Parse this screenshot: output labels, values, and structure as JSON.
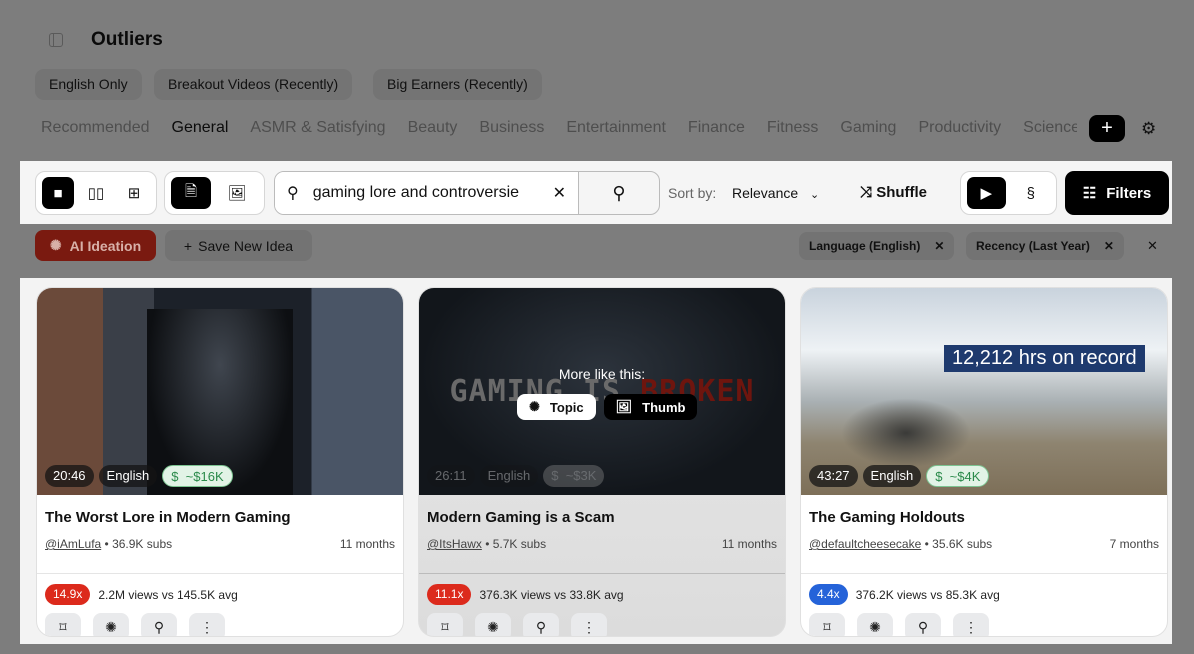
{
  "header": {
    "title": "Outliers",
    "sidebar_icon": "sidebar-toggle-icon"
  },
  "presets": [
    "English Only",
    "Breakout Videos (Recently)",
    "Big Earners (Recently)"
  ],
  "tabs": [
    "Recommended",
    "General",
    "ASMR & Satisfying",
    "Beauty",
    "Business",
    "Entertainment",
    "Finance",
    "Fitness",
    "Gaming",
    "Productivity",
    "Science"
  ],
  "active_tab": "General",
  "toolbar": {
    "search_value": "gaming lore and controversie",
    "sort_label": "Sort by:",
    "sort_value": "Relevance",
    "shuffle": "Shuffle",
    "filters": "Filters"
  },
  "actions": {
    "ai_ideation": "AI Ideation",
    "save_idea": "Save New Idea"
  },
  "active_filters": [
    "Language (English)",
    "Recency (Last Year)"
  ],
  "colors": {
    "accent_red": "#dc2a1c",
    "accent_blue": "#2563d9",
    "money_green": "#2a8a4a"
  },
  "cards": [
    {
      "title": "The Worst Lore in Modern Gaming",
      "channel": "@iAmLufa",
      "subs": "36.9K subs",
      "age": "11 months",
      "duration": "20:46",
      "language": "English",
      "earnings": "~$16K",
      "multiplier": "14.9x",
      "views": "2.2M views vs 145.5K avg"
    },
    {
      "title": "Modern Gaming is a Scam",
      "channel": "@ItsHawx",
      "subs": "5.7K subs",
      "age": "11 months",
      "duration": "26:11",
      "language": "English",
      "earnings": "~$3K",
      "multiplier": "11.1x",
      "views": "376.3K views vs 33.8K avg",
      "thumb_text": [
        "GAMING IS ",
        "BROKEN"
      ],
      "hover_label": "More like this:",
      "hover_topic": "Topic",
      "hover_thumb": "Thumb"
    },
    {
      "title": "The Gaming Holdouts",
      "channel": "@defaultcheesecake",
      "subs": "35.6K subs",
      "age": "7 months",
      "duration": "43:27",
      "language": "English",
      "earnings": "~$4K",
      "multiplier": "4.4x",
      "views": "376.2K views vs 85.3K avg",
      "thumb_text": "12,212 hrs on record"
    }
  ]
}
